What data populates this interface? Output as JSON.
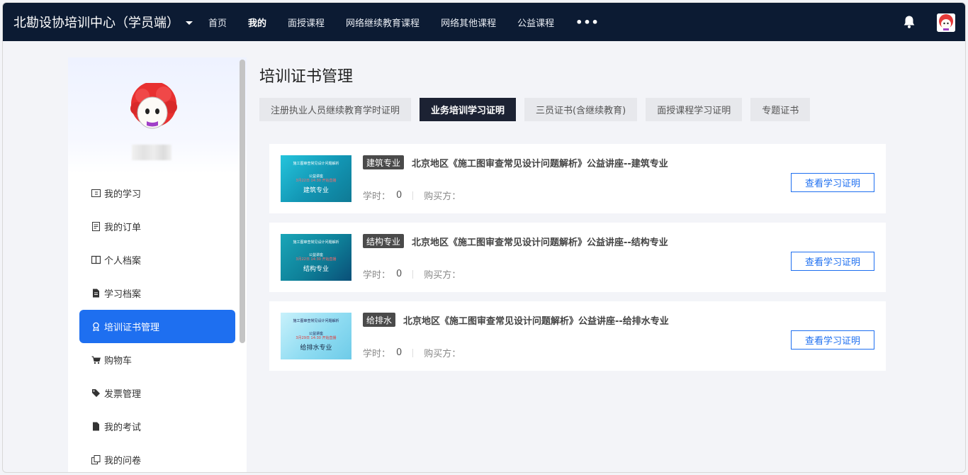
{
  "nav": {
    "brand": "北勘设协培训中心（学员端）",
    "links": [
      {
        "label": "首页",
        "active": false
      },
      {
        "label": "我的",
        "active": true
      },
      {
        "label": "面授课程",
        "active": false
      },
      {
        "label": "网络继续教育课程",
        "active": false
      },
      {
        "label": "网络其他课程",
        "active": false
      },
      {
        "label": "公益课程",
        "active": false
      }
    ],
    "more": "•••",
    "bell_icon": "bell-icon",
    "user_avatar": "avatar"
  },
  "sidebar": {
    "items": [
      {
        "label": "我的学习",
        "icon": "learning-icon",
        "active": false
      },
      {
        "label": "我的订单",
        "icon": "order-icon",
        "active": false
      },
      {
        "label": "个人档案",
        "icon": "profile-icon",
        "active": false
      },
      {
        "label": "学习档案",
        "icon": "file-icon",
        "active": false
      },
      {
        "label": "培训证书管理",
        "icon": "certificate-icon",
        "active": true
      },
      {
        "label": "购物车",
        "icon": "cart-icon",
        "active": false
      },
      {
        "label": "发票管理",
        "icon": "invoice-icon",
        "active": false
      },
      {
        "label": "我的考试",
        "icon": "exam-icon",
        "active": false
      },
      {
        "label": "我的问卷",
        "icon": "survey-icon",
        "active": false
      }
    ]
  },
  "main": {
    "title": "培训证书管理",
    "tabs": [
      {
        "label": "注册执业人员继续教育学时证明",
        "active": false
      },
      {
        "label": "业务培训学习证明",
        "active": true
      },
      {
        "label": "三员证书(含继续教育)",
        "active": false
      },
      {
        "label": "面授课程学习证明",
        "active": false
      },
      {
        "label": "专题证书",
        "active": false
      }
    ],
    "cards": [
      {
        "badge": "建筑专业",
        "title": "北京地区《施工图审查常见设计问题解析》公益讲座--建筑专业",
        "hours_label": "学时：",
        "hours": "0",
        "buyer_label": "购买方：",
        "button": "查看学习证明",
        "thumb_text": "建筑专业",
        "thumb_color": "#1aa8c4"
      },
      {
        "badge": "结构专业",
        "title": "北京地区《施工图审查常见设计问题解析》公益讲座--结构专业",
        "hours_label": "学时：",
        "hours": "0",
        "buyer_label": "购买方：",
        "button": "查看学习证明",
        "thumb_text": "结构专业",
        "thumb_color": "#0f7f9a"
      },
      {
        "badge": "给排水",
        "title": "北京地区《施工图审查常见设计问题解析》公益讲座--给排水专业",
        "hours_label": "学时：",
        "hours": "0",
        "buyer_label": "购买方：",
        "button": "查看学习证明",
        "thumb_text": "给排水专业",
        "thumb_color": "#8fdcf2"
      }
    ]
  },
  "colors": {
    "nav_bg": "#0c1b33",
    "accent": "#1e6ff0",
    "active_tab": "#1c2233"
  }
}
